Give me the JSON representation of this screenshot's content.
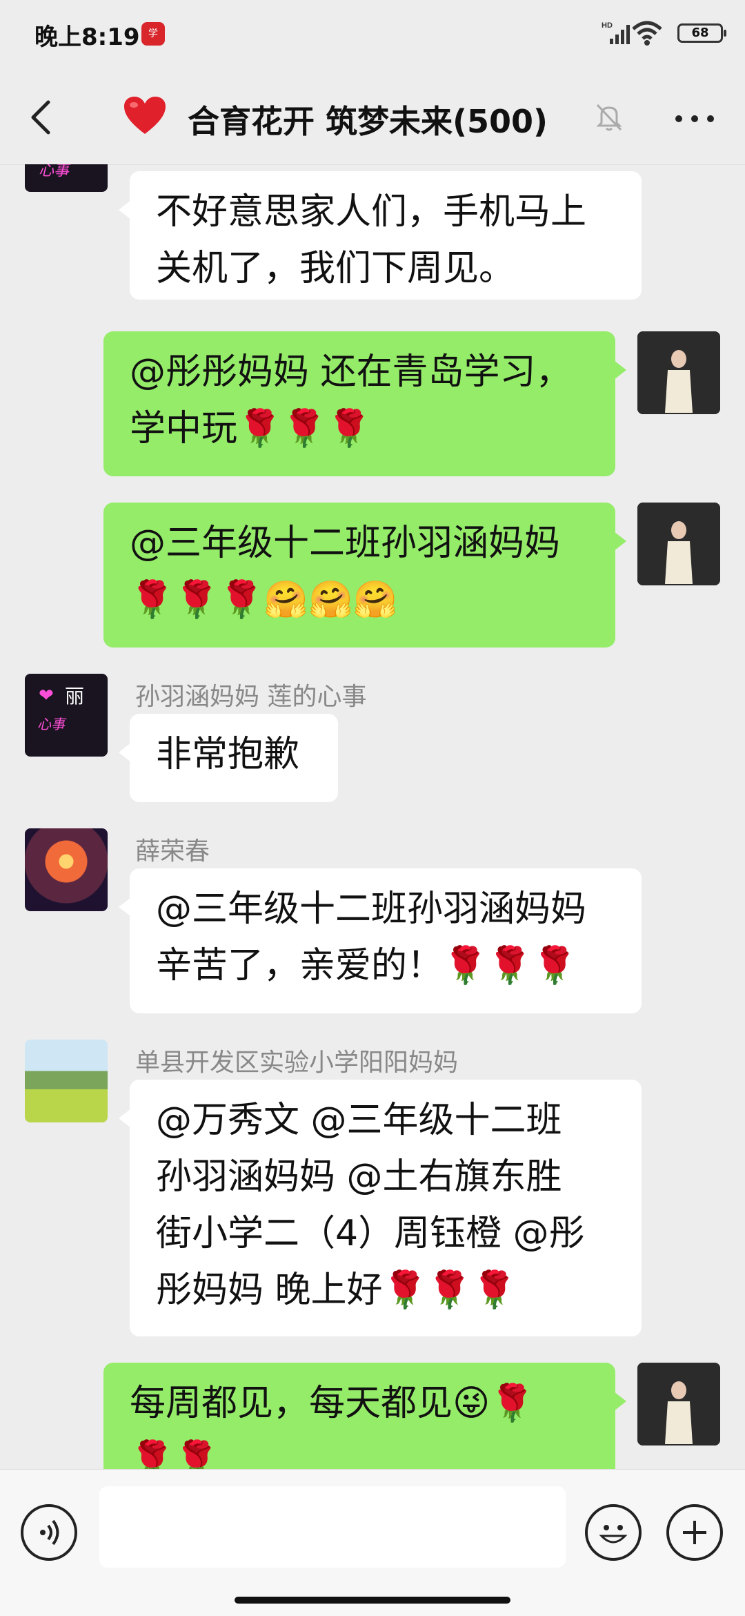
{
  "status": {
    "time": "晚上8:19",
    "network": "HD",
    "battery": "68"
  },
  "header": {
    "title": "合育花开 筑梦未来(500)"
  },
  "messages": [
    {
      "side": "in",
      "text": "不好意思家人们，手机马上关机了，我们下周见。"
    },
    {
      "side": "out",
      "line1": "@彤彤妈妈  还在青岛学习，",
      "line2": "学中玩🌹🌹🌹"
    },
    {
      "side": "out",
      "line1": "@三年级十二班孙羽涵妈妈",
      "line2": "🌹🌹🌹🤗🤗🤗"
    },
    {
      "side": "in",
      "sender": "孙羽涵妈妈  莲的心事",
      "text": "非常抱歉",
      "avatar_text": "丽"
    },
    {
      "side": "in",
      "sender": "薛荣春",
      "line1": "@三年级十二班孙羽涵妈妈",
      "line2": " 辛苦了，亲爱的！🌹🌹🌹"
    },
    {
      "side": "in",
      "sender": "单县开发区实验小学阳阳妈妈",
      "line1": "@万秀文  @三年级十二班",
      "line2": "孙羽涵妈妈  @土右旗东胜",
      "line3": "街小学二（4）周钰橙  @彤",
      "line4": "彤妈妈  晚上好🌹🌹🌹"
    },
    {
      "side": "out",
      "line1": "每周都见，每天都见😜🌹",
      "line2": "🌹🌹"
    }
  ],
  "input": {
    "placeholder": ""
  }
}
